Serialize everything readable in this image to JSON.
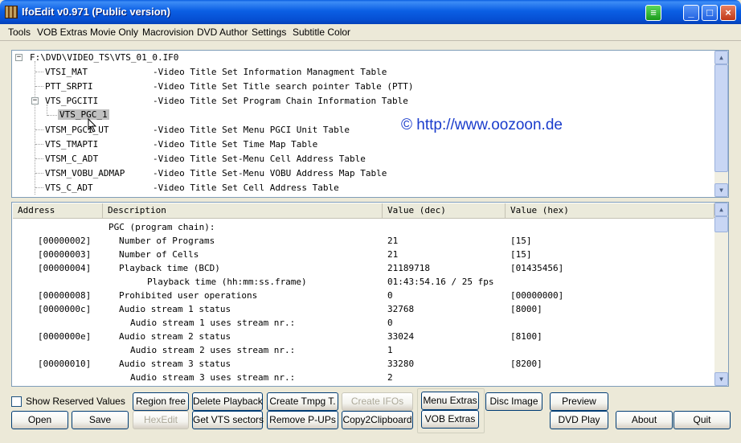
{
  "window": {
    "title": "IfoEdit v0.971 (Public version)",
    "controls": {
      "minimize": "_",
      "maximize": "□",
      "close": "×"
    }
  },
  "menu": [
    "Tools",
    "VOB Extras",
    "Movie Only",
    "Macrovision",
    "DVD Author",
    "Settings",
    "Subtitle Color"
  ],
  "tree": {
    "root": "F:\\DVD\\VIDEO_TS\\VTS_01_0.IF0",
    "nodes": [
      {
        "name": "VTSI_MAT",
        "desc": "-Video Title Set Information Managment Table"
      },
      {
        "name": "PTT_SRPTI",
        "desc": "-Video Title Set Title search pointer Table (PTT)"
      },
      {
        "name": "VTS_PGCITI",
        "desc": "-Video Title Set Program Chain Information Table",
        "expanded": true,
        "children": [
          "VTS_PGC_1"
        ]
      },
      {
        "name": "VTSM_PGCI_UT",
        "desc": "-Video Title Set Menu PGCI Unit Table"
      },
      {
        "name": "VTS_TMAPTI",
        "desc": "-Video Title Set Time Map Table"
      },
      {
        "name": "VTSM_C_ADT",
        "desc": "-Video Title Set-Menu Cell Address Table"
      },
      {
        "name": "VTSM_VOBU_ADMAP",
        "desc": "-Video Title Set-Menu VOBU Address Map Table"
      },
      {
        "name": "VTS_C_ADT",
        "desc": "-Video Title Set Cell Address Table"
      }
    ],
    "watermark": "© http://www.oozoon.de",
    "watermark_color": "#1a3ccc"
  },
  "table": {
    "columns": [
      "Address",
      "Description",
      "Value (dec)",
      "Value (hex)"
    ],
    "rows": [
      {
        "addr": "",
        "desc": "PGC (program chain):",
        "dec": "",
        "hex": ""
      },
      {
        "addr": "[00000002]",
        "desc": "Number of Programs",
        "dec": "21",
        "hex": "[15]"
      },
      {
        "addr": "[00000003]",
        "desc": "Number of Cells",
        "dec": "21",
        "hex": "[15]"
      },
      {
        "addr": "[00000004]",
        "desc": "Playback time (BCD)",
        "dec": "21189718",
        "hex": "[01435456]"
      },
      {
        "addr": "",
        "desc": "Playback time (hh:mm:ss.frame)",
        "dec": "01:43:54.16 / 25 fps",
        "hex": ""
      },
      {
        "addr": "[00000008]",
        "desc": "Prohibited user operations",
        "dec": "0",
        "hex": "[00000000]"
      },
      {
        "addr": "[0000000c]",
        "desc": "Audio stream 1 status",
        "dec": "32768",
        "hex": "[8000]"
      },
      {
        "addr": "",
        "desc": "Audio stream 1 uses stream nr.:",
        "dec": "0",
        "hex": ""
      },
      {
        "addr": "[0000000e]",
        "desc": "Audio stream 2 status",
        "dec": "33024",
        "hex": "[8100]"
      },
      {
        "addr": "",
        "desc": "Audio stream 2 uses stream nr.:",
        "dec": "1",
        "hex": ""
      },
      {
        "addr": "[00000010]",
        "desc": "Audio stream 3 status",
        "dec": "33280",
        "hex": "[8200]"
      },
      {
        "addr": "",
        "desc": "Audio stream 3 uses stream nr.:",
        "dec": "2",
        "hex": ""
      }
    ]
  },
  "buttons": {
    "show_reserved": "Show Reserved Values",
    "open": "Open",
    "save": "Save",
    "region_free": "Region free",
    "hexedit": "HexEdit",
    "delete_playback": "Delete Playback",
    "get_vts_sectors": "Get VTS sectors",
    "create_tmpg": "Create Tmpg T.",
    "remove_pups": "Remove P-UPs",
    "create_ifos": "Create IFOs",
    "copy_clipboard": "Copy2Clipboard",
    "menu_extras": "Menu Extras",
    "vob_extras": "VOB Extras",
    "disc_image": "Disc Image",
    "preview": "Preview",
    "dvd_play": "DVD Play",
    "about": "About",
    "quit": "Quit"
  }
}
